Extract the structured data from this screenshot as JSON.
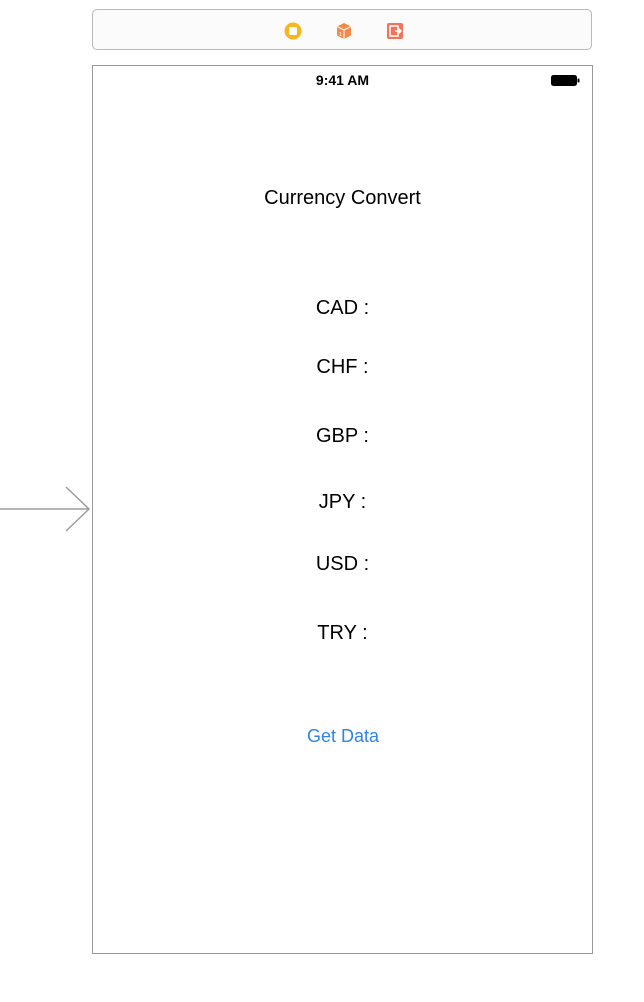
{
  "scene_dock": {
    "icons": [
      "view-controller-icon",
      "first-responder-icon",
      "exit-icon"
    ],
    "colors": {
      "view_controller": "#f7b51e",
      "first_responder": "#f28a4c",
      "exit": "#f0735a"
    }
  },
  "status_bar": {
    "time": "9:41 AM",
    "battery_icon": "battery-icon"
  },
  "title": "Currency Convert",
  "currencies": [
    {
      "label": "CAD :"
    },
    {
      "label": "CHF :"
    },
    {
      "label": "GBP :"
    },
    {
      "label": "JPY :"
    },
    {
      "label": "USD :"
    },
    {
      "label": "TRY :"
    }
  ],
  "get_data_button": {
    "label": "Get Data",
    "color": "#2f84e6"
  }
}
